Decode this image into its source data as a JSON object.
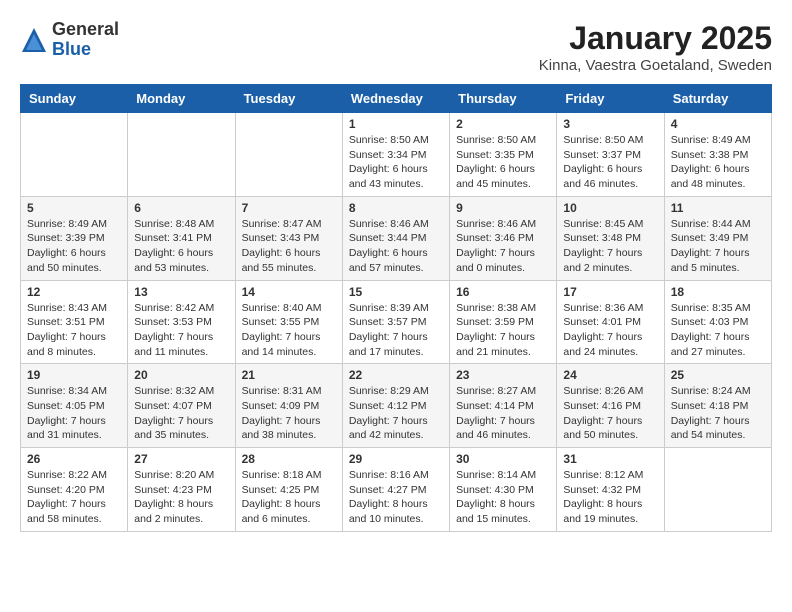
{
  "header": {
    "logo_general": "General",
    "logo_blue": "Blue",
    "title": "January 2025",
    "subtitle": "Kinna, Vaestra Goetaland, Sweden"
  },
  "calendar": {
    "days_of_week": [
      "Sunday",
      "Monday",
      "Tuesday",
      "Wednesday",
      "Thursday",
      "Friday",
      "Saturday"
    ],
    "weeks": [
      [
        {
          "day": "",
          "info": ""
        },
        {
          "day": "",
          "info": ""
        },
        {
          "day": "",
          "info": ""
        },
        {
          "day": "1",
          "info": "Sunrise: 8:50 AM\nSunset: 3:34 PM\nDaylight: 6 hours\nand 43 minutes."
        },
        {
          "day": "2",
          "info": "Sunrise: 8:50 AM\nSunset: 3:35 PM\nDaylight: 6 hours\nand 45 minutes."
        },
        {
          "day": "3",
          "info": "Sunrise: 8:50 AM\nSunset: 3:37 PM\nDaylight: 6 hours\nand 46 minutes."
        },
        {
          "day": "4",
          "info": "Sunrise: 8:49 AM\nSunset: 3:38 PM\nDaylight: 6 hours\nand 48 minutes."
        }
      ],
      [
        {
          "day": "5",
          "info": "Sunrise: 8:49 AM\nSunset: 3:39 PM\nDaylight: 6 hours\nand 50 minutes."
        },
        {
          "day": "6",
          "info": "Sunrise: 8:48 AM\nSunset: 3:41 PM\nDaylight: 6 hours\nand 53 minutes."
        },
        {
          "day": "7",
          "info": "Sunrise: 8:47 AM\nSunset: 3:43 PM\nDaylight: 6 hours\nand 55 minutes."
        },
        {
          "day": "8",
          "info": "Sunrise: 8:46 AM\nSunset: 3:44 PM\nDaylight: 6 hours\nand 57 minutes."
        },
        {
          "day": "9",
          "info": "Sunrise: 8:46 AM\nSunset: 3:46 PM\nDaylight: 7 hours\nand 0 minutes."
        },
        {
          "day": "10",
          "info": "Sunrise: 8:45 AM\nSunset: 3:48 PM\nDaylight: 7 hours\nand 2 minutes."
        },
        {
          "day": "11",
          "info": "Sunrise: 8:44 AM\nSunset: 3:49 PM\nDaylight: 7 hours\nand 5 minutes."
        }
      ],
      [
        {
          "day": "12",
          "info": "Sunrise: 8:43 AM\nSunset: 3:51 PM\nDaylight: 7 hours\nand 8 minutes."
        },
        {
          "day": "13",
          "info": "Sunrise: 8:42 AM\nSunset: 3:53 PM\nDaylight: 7 hours\nand 11 minutes."
        },
        {
          "day": "14",
          "info": "Sunrise: 8:40 AM\nSunset: 3:55 PM\nDaylight: 7 hours\nand 14 minutes."
        },
        {
          "day": "15",
          "info": "Sunrise: 8:39 AM\nSunset: 3:57 PM\nDaylight: 7 hours\nand 17 minutes."
        },
        {
          "day": "16",
          "info": "Sunrise: 8:38 AM\nSunset: 3:59 PM\nDaylight: 7 hours\nand 21 minutes."
        },
        {
          "day": "17",
          "info": "Sunrise: 8:36 AM\nSunset: 4:01 PM\nDaylight: 7 hours\nand 24 minutes."
        },
        {
          "day": "18",
          "info": "Sunrise: 8:35 AM\nSunset: 4:03 PM\nDaylight: 7 hours\nand 27 minutes."
        }
      ],
      [
        {
          "day": "19",
          "info": "Sunrise: 8:34 AM\nSunset: 4:05 PM\nDaylight: 7 hours\nand 31 minutes."
        },
        {
          "day": "20",
          "info": "Sunrise: 8:32 AM\nSunset: 4:07 PM\nDaylight: 7 hours\nand 35 minutes."
        },
        {
          "day": "21",
          "info": "Sunrise: 8:31 AM\nSunset: 4:09 PM\nDaylight: 7 hours\nand 38 minutes."
        },
        {
          "day": "22",
          "info": "Sunrise: 8:29 AM\nSunset: 4:12 PM\nDaylight: 7 hours\nand 42 minutes."
        },
        {
          "day": "23",
          "info": "Sunrise: 8:27 AM\nSunset: 4:14 PM\nDaylight: 7 hours\nand 46 minutes."
        },
        {
          "day": "24",
          "info": "Sunrise: 8:26 AM\nSunset: 4:16 PM\nDaylight: 7 hours\nand 50 minutes."
        },
        {
          "day": "25",
          "info": "Sunrise: 8:24 AM\nSunset: 4:18 PM\nDaylight: 7 hours\nand 54 minutes."
        }
      ],
      [
        {
          "day": "26",
          "info": "Sunrise: 8:22 AM\nSunset: 4:20 PM\nDaylight: 7 hours\nand 58 minutes."
        },
        {
          "day": "27",
          "info": "Sunrise: 8:20 AM\nSunset: 4:23 PM\nDaylight: 8 hours\nand 2 minutes."
        },
        {
          "day": "28",
          "info": "Sunrise: 8:18 AM\nSunset: 4:25 PM\nDaylight: 8 hours\nand 6 minutes."
        },
        {
          "day": "29",
          "info": "Sunrise: 8:16 AM\nSunset: 4:27 PM\nDaylight: 8 hours\nand 10 minutes."
        },
        {
          "day": "30",
          "info": "Sunrise: 8:14 AM\nSunset: 4:30 PM\nDaylight: 8 hours\nand 15 minutes."
        },
        {
          "day": "31",
          "info": "Sunrise: 8:12 AM\nSunset: 4:32 PM\nDaylight: 8 hours\nand 19 minutes."
        },
        {
          "day": "",
          "info": ""
        }
      ]
    ]
  }
}
